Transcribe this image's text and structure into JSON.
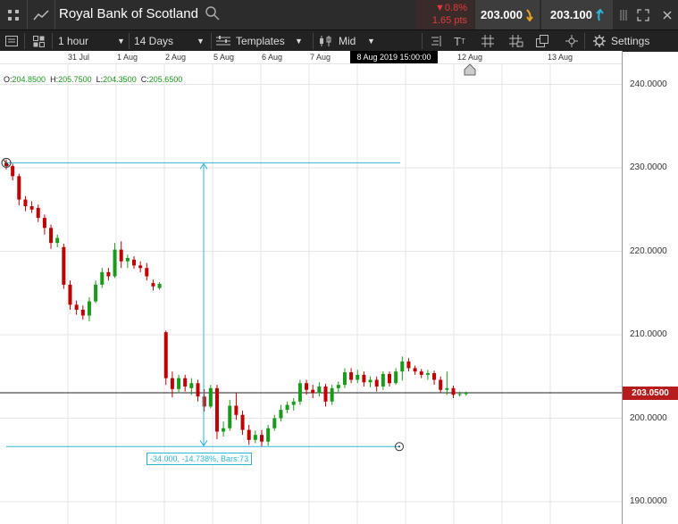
{
  "header": {
    "title": "Royal Bank of Scotland",
    "change_pct": "▼0.8%",
    "change_pts": "1.65 pts",
    "bid": "203.000",
    "ask": "203.100"
  },
  "toolbar": {
    "interval": "1 hour",
    "range": "14 Days",
    "templates": "Templates",
    "price_type": "Mid",
    "settings": "Settings"
  },
  "time_axis": {
    "labels": [
      "31 Jul",
      "1 Aug",
      "2 Aug",
      "5 Aug",
      "6 Aug",
      "7 Aug",
      "12 Aug",
      "13 Aug"
    ],
    "hover_label": "8 Aug 2019 15:00:00"
  },
  "ohlc": {
    "o_label": "O:",
    "o": "204.8500",
    "h_label": "H:",
    "h": "205.7500",
    "l_label": "L:",
    "l": "204.3500",
    "c_label": "C:",
    "c": "205.6500"
  },
  "price_axis": {
    "labels": [
      "240.0000",
      "230.0000",
      "220.0000",
      "210.0000",
      "200.0000",
      "190.0000"
    ],
    "current": "203.0500"
  },
  "measure": {
    "label": "-34.000, -14.738%, Bars:73"
  },
  "colors": {
    "up": "#1a9a1a",
    "down": "#c00000",
    "tool": "#2bb5d6",
    "topbar": "#2c2c2c"
  },
  "chart_data": {
    "type": "candlestick",
    "interval": "1 hour",
    "ylim": [
      186,
      243
    ],
    "current_price": 203.05,
    "measure_from": 230.6,
    "measure_to": 196.6,
    "candles": [
      [
        230.6,
        231.0,
        229.8,
        230.2
      ],
      [
        230.2,
        230.5,
        228.5,
        229.0
      ],
      [
        229.0,
        229.3,
        225.5,
        226.2
      ],
      [
        226.2,
        226.6,
        224.8,
        225.4
      ],
      [
        225.4,
        226.0,
        224.6,
        225.0
      ],
      [
        225.2,
        225.6,
        223.5,
        224.0
      ],
      [
        224.0,
        224.4,
        222.0,
        222.8
      ],
      [
        222.8,
        223.2,
        220.3,
        221.0
      ],
      [
        221.0,
        222.0,
        220.5,
        221.6
      ],
      [
        220.5,
        220.9,
        215.5,
        216.0
      ],
      [
        216.0,
        216.5,
        213.0,
        213.6
      ],
      [
        213.6,
        214.1,
        212.4,
        213.0
      ],
      [
        213.0,
        213.5,
        211.8,
        212.3
      ],
      [
        212.3,
        214.5,
        211.6,
        214.0
      ],
      [
        214.0,
        216.5,
        213.8,
        216.0
      ],
      [
        216.0,
        218.0,
        215.6,
        217.5
      ],
      [
        217.5,
        218.0,
        216.5,
        217.0
      ],
      [
        217.0,
        221.0,
        216.8,
        220.2
      ],
      [
        220.2,
        221.2,
        218.0,
        218.8
      ],
      [
        218.8,
        219.6,
        218.0,
        219.2
      ],
      [
        219.0,
        219.4,
        217.9,
        218.3
      ],
      [
        218.3,
        218.8,
        217.5,
        218.0
      ],
      [
        218.0,
        218.6,
        216.5,
        217.0
      ],
      [
        216.2,
        216.6,
        215.3,
        215.8
      ],
      [
        215.6,
        216.3,
        215.4,
        216.1
      ],
      [
        210.3,
        210.5,
        204.0,
        204.8
      ],
      [
        204.8,
        205.6,
        202.5,
        203.5
      ],
      [
        203.5,
        205.2,
        203.0,
        204.8
      ],
      [
        204.8,
        205.2,
        203.2,
        203.8
      ],
      [
        203.6,
        204.8,
        202.8,
        204.2
      ],
      [
        204.2,
        204.6,
        202.0,
        202.6
      ],
      [
        202.6,
        203.5,
        200.8,
        201.4
      ],
      [
        201.4,
        204.0,
        201.2,
        203.6
      ],
      [
        203.6,
        204.0,
        197.5,
        198.4
      ],
      [
        198.4,
        199.6,
        197.8,
        198.8
      ],
      [
        198.8,
        202.2,
        198.5,
        201.5
      ],
      [
        201.5,
        203.0,
        199.8,
        200.4
      ],
      [
        200.4,
        200.9,
        198.0,
        198.6
      ],
      [
        198.6,
        199.2,
        196.8,
        197.4
      ],
      [
        197.4,
        198.5,
        197.0,
        198.0
      ],
      [
        198.0,
        198.6,
        196.6,
        197.2
      ],
      [
        197.2,
        199.2,
        196.7,
        198.8
      ],
      [
        198.8,
        200.4,
        198.5,
        200.0
      ],
      [
        200.0,
        201.6,
        199.6,
        201.0
      ],
      [
        201.0,
        202.0,
        200.6,
        201.6
      ],
      [
        201.6,
        202.4,
        200.9,
        202.0
      ],
      [
        202.0,
        204.6,
        201.6,
        204.2
      ],
      [
        204.2,
        204.6,
        202.8,
        203.4
      ],
      [
        203.4,
        204.0,
        202.4,
        203.0
      ],
      [
        203.0,
        204.3,
        202.6,
        203.8
      ],
      [
        203.8,
        204.1,
        201.4,
        202.0
      ],
      [
        202.0,
        204.0,
        201.6,
        203.6
      ],
      [
        203.6,
        204.4,
        203.0,
        204.0
      ],
      [
        204.0,
        206.0,
        203.6,
        205.5
      ],
      [
        205.5,
        206.0,
        204.2,
        204.6
      ],
      [
        204.6,
        205.8,
        204.2,
        205.2
      ],
      [
        205.2,
        205.6,
        203.8,
        204.3
      ],
      [
        204.3,
        205.0,
        203.7,
        204.6
      ],
      [
        204.6,
        205.0,
        203.2,
        203.8
      ],
      [
        203.8,
        205.6,
        203.4,
        205.3
      ],
      [
        205.3,
        205.6,
        203.8,
        204.2
      ],
      [
        204.2,
        206.0,
        204.0,
        205.6
      ],
      [
        205.6,
        207.4,
        204.5,
        206.8
      ],
      [
        206.8,
        207.2,
        205.6,
        206.0
      ],
      [
        206.0,
        206.3,
        205.2,
        205.6
      ],
      [
        205.6,
        205.9,
        204.8,
        205.2
      ],
      [
        205.2,
        205.8,
        204.6,
        205.4
      ],
      [
        205.4,
        205.7,
        204.0,
        204.6
      ],
      [
        204.6,
        205.0,
        203.0,
        203.4
      ],
      [
        203.4,
        205.6,
        202.8,
        203.6
      ],
      [
        203.6,
        203.9,
        202.4,
        202.8
      ],
      [
        202.8,
        203.2,
        202.6,
        202.9
      ],
      [
        202.9,
        203.2,
        202.7,
        203.05
      ]
    ]
  }
}
